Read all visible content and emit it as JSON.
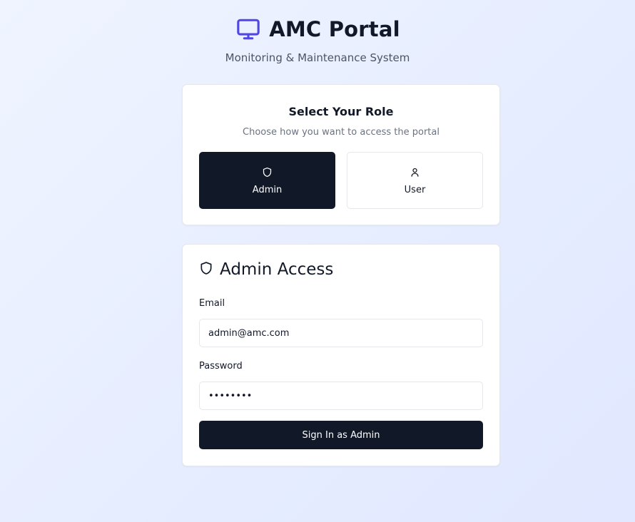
{
  "header": {
    "logo_icon": "monitor-icon",
    "title": "AMC Portal",
    "subtitle": "Monitoring & Maintenance System"
  },
  "role_selector": {
    "title": "Select Your Role",
    "description": "Choose how you want to access the portal",
    "options": [
      {
        "label": "Admin",
        "icon": "shield-icon",
        "selected": true
      },
      {
        "label": "User",
        "icon": "user-icon",
        "selected": false
      }
    ]
  },
  "login": {
    "icon": "shield-icon",
    "title": "Admin Access",
    "email_label": "Email",
    "email_value": "admin@amc.com",
    "password_label": "Password",
    "password_value": "password",
    "submit_label": "Sign In as Admin"
  },
  "colors": {
    "accent": "#4f46e5",
    "primary_dark": "#111827",
    "background": "#e8eeff"
  }
}
